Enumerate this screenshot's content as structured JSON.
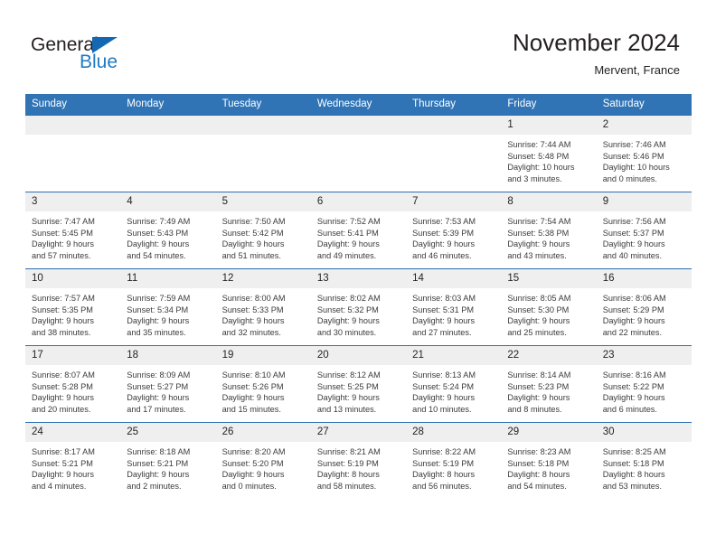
{
  "brand": {
    "name_part1": "General",
    "name_part2": "Blue",
    "triangle_icon": "triangle-icon",
    "accent_color": "#1468b3"
  },
  "header": {
    "title": "November 2024",
    "subtitle": "Mervent, France"
  },
  "calendar": {
    "header_bg": "#3074b6",
    "daynum_bg": "#efefef",
    "row_border": "#2d6fb0",
    "weekday_headers": [
      "Sunday",
      "Monday",
      "Tuesday",
      "Wednesday",
      "Thursday",
      "Friday",
      "Saturday"
    ],
    "weeks": [
      [
        {
          "day": "",
          "sunrise": "",
          "sunset": "",
          "daylight_line1": "",
          "daylight_line2": "",
          "empty": true
        },
        {
          "day": "",
          "sunrise": "",
          "sunset": "",
          "daylight_line1": "",
          "daylight_line2": "",
          "empty": true
        },
        {
          "day": "",
          "sunrise": "",
          "sunset": "",
          "daylight_line1": "",
          "daylight_line2": "",
          "empty": true
        },
        {
          "day": "",
          "sunrise": "",
          "sunset": "",
          "daylight_line1": "",
          "daylight_line2": "",
          "empty": true
        },
        {
          "day": "",
          "sunrise": "",
          "sunset": "",
          "daylight_line1": "",
          "daylight_line2": "",
          "empty": true
        },
        {
          "day": "1",
          "sunrise": "Sunrise: 7:44 AM",
          "sunset": "Sunset: 5:48 PM",
          "daylight_line1": "Daylight: 10 hours",
          "daylight_line2": "and 3 minutes.",
          "empty": false
        },
        {
          "day": "2",
          "sunrise": "Sunrise: 7:46 AM",
          "sunset": "Sunset: 5:46 PM",
          "daylight_line1": "Daylight: 10 hours",
          "daylight_line2": "and 0 minutes.",
          "empty": false
        }
      ],
      [
        {
          "day": "3",
          "sunrise": "Sunrise: 7:47 AM",
          "sunset": "Sunset: 5:45 PM",
          "daylight_line1": "Daylight: 9 hours",
          "daylight_line2": "and 57 minutes.",
          "empty": false
        },
        {
          "day": "4",
          "sunrise": "Sunrise: 7:49 AM",
          "sunset": "Sunset: 5:43 PM",
          "daylight_line1": "Daylight: 9 hours",
          "daylight_line2": "and 54 minutes.",
          "empty": false
        },
        {
          "day": "5",
          "sunrise": "Sunrise: 7:50 AM",
          "sunset": "Sunset: 5:42 PM",
          "daylight_line1": "Daylight: 9 hours",
          "daylight_line2": "and 51 minutes.",
          "empty": false
        },
        {
          "day": "6",
          "sunrise": "Sunrise: 7:52 AM",
          "sunset": "Sunset: 5:41 PM",
          "daylight_line1": "Daylight: 9 hours",
          "daylight_line2": "and 49 minutes.",
          "empty": false
        },
        {
          "day": "7",
          "sunrise": "Sunrise: 7:53 AM",
          "sunset": "Sunset: 5:39 PM",
          "daylight_line1": "Daylight: 9 hours",
          "daylight_line2": "and 46 minutes.",
          "empty": false
        },
        {
          "day": "8",
          "sunrise": "Sunrise: 7:54 AM",
          "sunset": "Sunset: 5:38 PM",
          "daylight_line1": "Daylight: 9 hours",
          "daylight_line2": "and 43 minutes.",
          "empty": false
        },
        {
          "day": "9",
          "sunrise": "Sunrise: 7:56 AM",
          "sunset": "Sunset: 5:37 PM",
          "daylight_line1": "Daylight: 9 hours",
          "daylight_line2": "and 40 minutes.",
          "empty": false
        }
      ],
      [
        {
          "day": "10",
          "sunrise": "Sunrise: 7:57 AM",
          "sunset": "Sunset: 5:35 PM",
          "daylight_line1": "Daylight: 9 hours",
          "daylight_line2": "and 38 minutes.",
          "empty": false
        },
        {
          "day": "11",
          "sunrise": "Sunrise: 7:59 AM",
          "sunset": "Sunset: 5:34 PM",
          "daylight_line1": "Daylight: 9 hours",
          "daylight_line2": "and 35 minutes.",
          "empty": false
        },
        {
          "day": "12",
          "sunrise": "Sunrise: 8:00 AM",
          "sunset": "Sunset: 5:33 PM",
          "daylight_line1": "Daylight: 9 hours",
          "daylight_line2": "and 32 minutes.",
          "empty": false
        },
        {
          "day": "13",
          "sunrise": "Sunrise: 8:02 AM",
          "sunset": "Sunset: 5:32 PM",
          "daylight_line1": "Daylight: 9 hours",
          "daylight_line2": "and 30 minutes.",
          "empty": false
        },
        {
          "day": "14",
          "sunrise": "Sunrise: 8:03 AM",
          "sunset": "Sunset: 5:31 PM",
          "daylight_line1": "Daylight: 9 hours",
          "daylight_line2": "and 27 minutes.",
          "empty": false
        },
        {
          "day": "15",
          "sunrise": "Sunrise: 8:05 AM",
          "sunset": "Sunset: 5:30 PM",
          "daylight_line1": "Daylight: 9 hours",
          "daylight_line2": "and 25 minutes.",
          "empty": false
        },
        {
          "day": "16",
          "sunrise": "Sunrise: 8:06 AM",
          "sunset": "Sunset: 5:29 PM",
          "daylight_line1": "Daylight: 9 hours",
          "daylight_line2": "and 22 minutes.",
          "empty": false
        }
      ],
      [
        {
          "day": "17",
          "sunrise": "Sunrise: 8:07 AM",
          "sunset": "Sunset: 5:28 PM",
          "daylight_line1": "Daylight: 9 hours",
          "daylight_line2": "and 20 minutes.",
          "empty": false
        },
        {
          "day": "18",
          "sunrise": "Sunrise: 8:09 AM",
          "sunset": "Sunset: 5:27 PM",
          "daylight_line1": "Daylight: 9 hours",
          "daylight_line2": "and 17 minutes.",
          "empty": false
        },
        {
          "day": "19",
          "sunrise": "Sunrise: 8:10 AM",
          "sunset": "Sunset: 5:26 PM",
          "daylight_line1": "Daylight: 9 hours",
          "daylight_line2": "and 15 minutes.",
          "empty": false
        },
        {
          "day": "20",
          "sunrise": "Sunrise: 8:12 AM",
          "sunset": "Sunset: 5:25 PM",
          "daylight_line1": "Daylight: 9 hours",
          "daylight_line2": "and 13 minutes.",
          "empty": false
        },
        {
          "day": "21",
          "sunrise": "Sunrise: 8:13 AM",
          "sunset": "Sunset: 5:24 PM",
          "daylight_line1": "Daylight: 9 hours",
          "daylight_line2": "and 10 minutes.",
          "empty": false
        },
        {
          "day": "22",
          "sunrise": "Sunrise: 8:14 AM",
          "sunset": "Sunset: 5:23 PM",
          "daylight_line1": "Daylight: 9 hours",
          "daylight_line2": "and 8 minutes.",
          "empty": false
        },
        {
          "day": "23",
          "sunrise": "Sunrise: 8:16 AM",
          "sunset": "Sunset: 5:22 PM",
          "daylight_line1": "Daylight: 9 hours",
          "daylight_line2": "and 6 minutes.",
          "empty": false
        }
      ],
      [
        {
          "day": "24",
          "sunrise": "Sunrise: 8:17 AM",
          "sunset": "Sunset: 5:21 PM",
          "daylight_line1": "Daylight: 9 hours",
          "daylight_line2": "and 4 minutes.",
          "empty": false
        },
        {
          "day": "25",
          "sunrise": "Sunrise: 8:18 AM",
          "sunset": "Sunset: 5:21 PM",
          "daylight_line1": "Daylight: 9 hours",
          "daylight_line2": "and 2 minutes.",
          "empty": false
        },
        {
          "day": "26",
          "sunrise": "Sunrise: 8:20 AM",
          "sunset": "Sunset: 5:20 PM",
          "daylight_line1": "Daylight: 9 hours",
          "daylight_line2": "and 0 minutes.",
          "empty": false
        },
        {
          "day": "27",
          "sunrise": "Sunrise: 8:21 AM",
          "sunset": "Sunset: 5:19 PM",
          "daylight_line1": "Daylight: 8 hours",
          "daylight_line2": "and 58 minutes.",
          "empty": false
        },
        {
          "day": "28",
          "sunrise": "Sunrise: 8:22 AM",
          "sunset": "Sunset: 5:19 PM",
          "daylight_line1": "Daylight: 8 hours",
          "daylight_line2": "and 56 minutes.",
          "empty": false
        },
        {
          "day": "29",
          "sunrise": "Sunrise: 8:23 AM",
          "sunset": "Sunset: 5:18 PM",
          "daylight_line1": "Daylight: 8 hours",
          "daylight_line2": "and 54 minutes.",
          "empty": false
        },
        {
          "day": "30",
          "sunrise": "Sunrise: 8:25 AM",
          "sunset": "Sunset: 5:18 PM",
          "daylight_line1": "Daylight: 8 hours",
          "daylight_line2": "and 53 minutes.",
          "empty": false
        }
      ]
    ]
  }
}
